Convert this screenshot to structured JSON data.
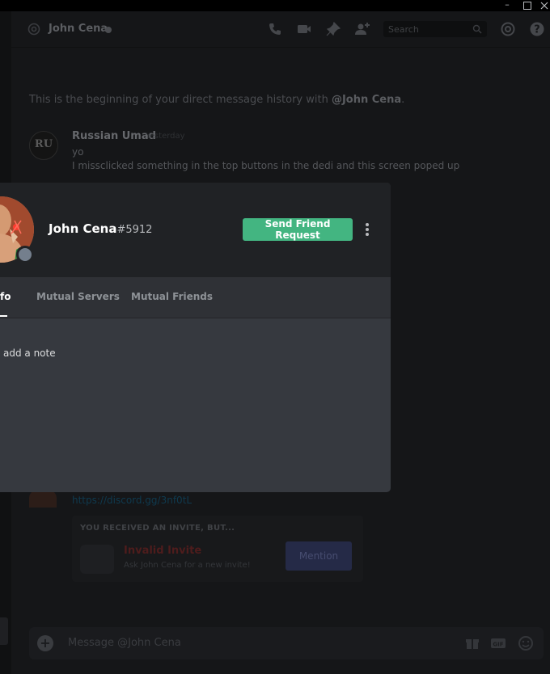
{
  "window": {
    "minimize_icon": "minimize-icon",
    "maximize_icon": "maximize-icon",
    "close_icon": "close-icon"
  },
  "header": {
    "channel_name": "John Cena",
    "search_placeholder": "Search",
    "icons": [
      "at-icon",
      "phone-call-icon",
      "video-call-icon",
      "pin-icon",
      "add-friend-icon",
      "search-icon",
      "mention-icon",
      "help-icon"
    ]
  },
  "chat": {
    "beginning_text": "This is the beginning of your direct message history with ",
    "beginning_user": "@John Cena",
    "beginning_end": ".",
    "message": {
      "author": "Russian Umad",
      "avatar_text": "RU",
      "time": "Yesterday",
      "lines": [
        "yo",
        "I missclicked something in the top buttons in the dedi and this screen poped up"
      ]
    },
    "invite_link": "https://discord.gg/3nf0tL",
    "invite": {
      "header": "YOU RECEIVED AN INVITE, BUT...",
      "title": "Invalid Invite",
      "subtitle": "Ask John Cena for a new invite!",
      "button": "Mention"
    },
    "composer": {
      "placeholder": "Message @John Cena",
      "icons": [
        "gift-icon",
        "gif-icon",
        "emoji-icon"
      ]
    }
  },
  "profile": {
    "username": "John Cena",
    "discriminator": "#5912",
    "status": "offline",
    "send_friend_request": "Send Friend Request",
    "tabs": [
      {
        "label": "fo",
        "active": true
      },
      {
        "label": "Mutual Servers",
        "active": false
      },
      {
        "label": "Mutual Friends",
        "active": false
      }
    ],
    "note_placeholder": "add a note"
  },
  "colors": {
    "accent_green": "#43b581",
    "modal_bg": "#36393f",
    "modal_header_bg": "#202225",
    "tabbar_bg": "#2f3136",
    "mention_button": "#252a47"
  }
}
